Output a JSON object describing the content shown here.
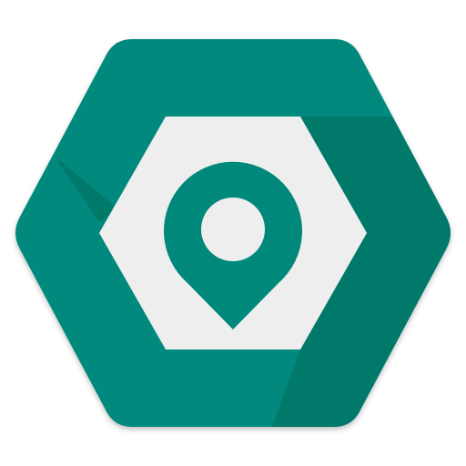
{
  "icon": {
    "name": "map-pin-hexagon-app-icon",
    "colors": {
      "outer_hexagon": "#00897B",
      "outer_shadow": "#00796B",
      "inner_hexagon": "#EEEEEE",
      "pin": "#00897B",
      "pin_hole": "#EEEEEE"
    }
  }
}
